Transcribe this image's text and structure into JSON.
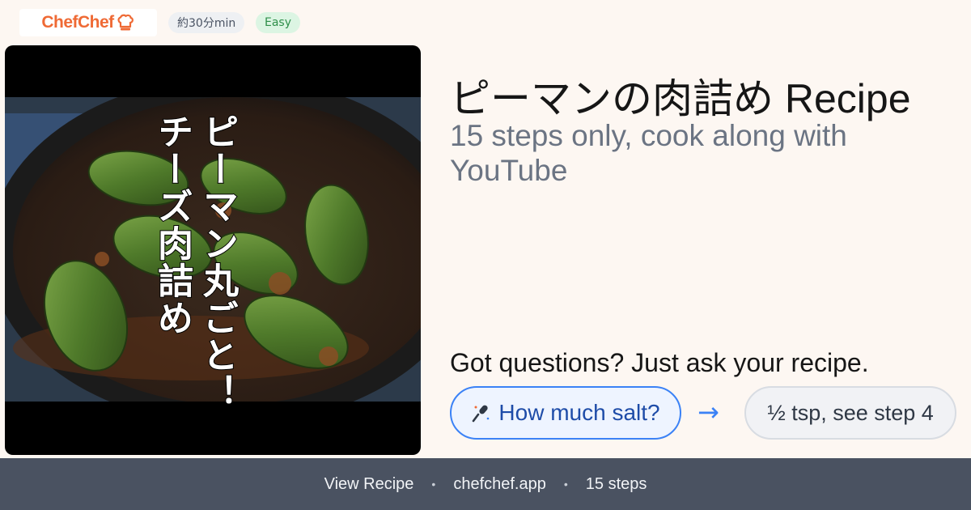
{
  "brand": {
    "logo_text": "ChefChef",
    "logo_icon": "chef-hat-icon",
    "accent": "#ef6a35"
  },
  "badges": {
    "time": "約30分min",
    "difficulty": "Easy"
  },
  "photo": {
    "overlay_line1": "ピーマン丸ごと！",
    "overlay_line2": "チーズ肉詰め"
  },
  "recipe": {
    "title": "ピーマンの肉詰め Recipe",
    "subtitle": "15 steps only, cook along with YouTube"
  },
  "ask": {
    "heading": "Got questions? Just ask your recipe.",
    "question_icon": "microphone-icon",
    "question": "How much salt?",
    "arrow": "→",
    "answer": "½ tsp, see step 4"
  },
  "footer": {
    "view": "View Recipe",
    "sep": "•",
    "domain": "chefchef.app",
    "steps": "15 steps"
  },
  "colors": {
    "background": "#fdf7f2",
    "footer_bg": "#4a5261",
    "question_border": "#3b82f6"
  }
}
